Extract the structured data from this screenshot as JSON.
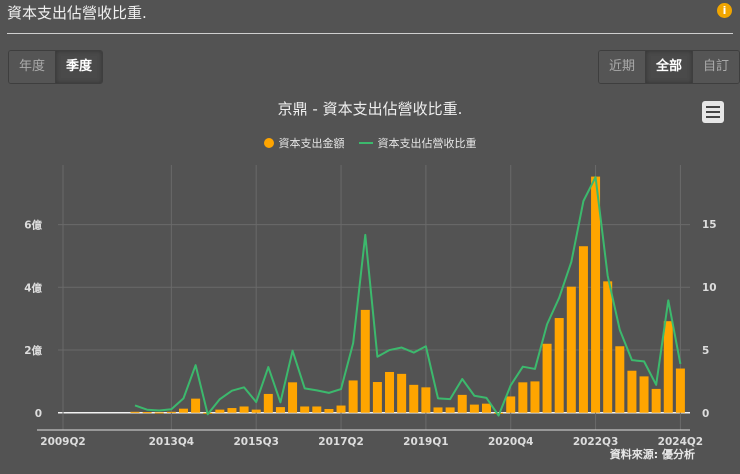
{
  "header": {
    "title": "資本支出佔營收比重.",
    "info_icon": "info-icon"
  },
  "period_buttons": [
    {
      "label": "年度",
      "active": false
    },
    {
      "label": "季度",
      "active": true
    }
  ],
  "range_buttons": [
    {
      "label": "近期",
      "active": false
    },
    {
      "label": "全部",
      "active": true
    },
    {
      "label": "自訂",
      "active": false
    }
  ],
  "source": "資料來源: 優分析",
  "colors": {
    "bar": "#ffa500",
    "line": "#3cb96d",
    "background": "#535353"
  },
  "chart_data": {
    "type": "bar+line",
    "title": "京鼎 - 資本支出佔營收比重.",
    "legend": [
      "資本支出金額",
      "資本支出佔營收比重"
    ],
    "legend_position": "top-center",
    "categories": [
      "2013Q1",
      "2013Q2",
      "2013Q3",
      "2013Q4",
      "2014Q1",
      "2014Q2",
      "2014Q3",
      "2014Q4",
      "2015Q1",
      "2015Q2",
      "2015Q3",
      "2015Q4",
      "2016Q1",
      "2016Q2",
      "2016Q3",
      "2016Q4",
      "2017Q1",
      "2017Q2",
      "2017Q3",
      "2017Q4",
      "2018Q1",
      "2018Q2",
      "2018Q3",
      "2018Q4",
      "2019Q1",
      "2019Q2",
      "2019Q3",
      "2019Q4",
      "2020Q1",
      "2020Q2",
      "2020Q3",
      "2020Q4",
      "2021Q1",
      "2021Q2",
      "2021Q3",
      "2021Q4",
      "2022Q1",
      "2022Q2",
      "2022Q3",
      "2022Q4",
      "2023Q1",
      "2023Q2",
      "2023Q3",
      "2023Q4",
      "2024Q1",
      "2024Q2"
    ],
    "x_tick_labels": [
      "2009Q2",
      "2013Q4",
      "2015Q3",
      "2017Q2",
      "2019Q1",
      "2020Q4",
      "2022Q3",
      "2024Q2"
    ],
    "series": [
      {
        "name": "資本支出金額",
        "type": "bar",
        "axis": "left",
        "unit": "億",
        "values": [
          0.03,
          0.02,
          0.01,
          0.03,
          0.13,
          0.45,
          -0.02,
          0.1,
          0.15,
          0.2,
          0.1,
          0.6,
          0.18,
          0.97,
          0.2,
          0.2,
          0.12,
          0.23,
          1.03,
          3.28,
          0.98,
          1.3,
          1.24,
          0.89,
          0.81,
          0.17,
          0.17,
          0.57,
          0.26,
          0.29,
          -0.02,
          0.52,
          0.97,
          1.0,
          2.2,
          3.02,
          4.02,
          5.31,
          7.53,
          4.19,
          2.12,
          1.34,
          1.16,
          0.76,
          2.92,
          1.41
        ]
      },
      {
        "name": "資本支出佔營收比重",
        "type": "line",
        "axis": "right",
        "unit": "%",
        "values": [
          0.6,
          0.26,
          0.2,
          0.3,
          1.16,
          3.8,
          -0.1,
          1.1,
          1.77,
          2.04,
          0.87,
          3.65,
          0.85,
          4.95,
          1.96,
          1.8,
          1.6,
          1.9,
          5.55,
          14.15,
          4.47,
          5.0,
          5.2,
          4.8,
          5.3,
          1.16,
          1.1,
          2.7,
          1.37,
          1.2,
          -0.2,
          2.2,
          3.68,
          3.5,
          7.05,
          9.16,
          12.0,
          16.84,
          18.74,
          10.9,
          6.6,
          4.2,
          4.1,
          2.24,
          8.95,
          3.9
        ]
      }
    ],
    "y_left": {
      "ticks": [
        "0",
        "2億",
        "4億",
        "6億"
      ],
      "tick_values": [
        0,
        2,
        4,
        6
      ],
      "range": [
        -0.55,
        7.9
      ]
    },
    "y_right": {
      "ticks": [
        "0",
        "5",
        "10",
        "15"
      ],
      "tick_values": [
        0,
        5,
        10,
        15
      ],
      "range": [
        -1.35,
        19.7
      ]
    },
    "grid": true
  }
}
